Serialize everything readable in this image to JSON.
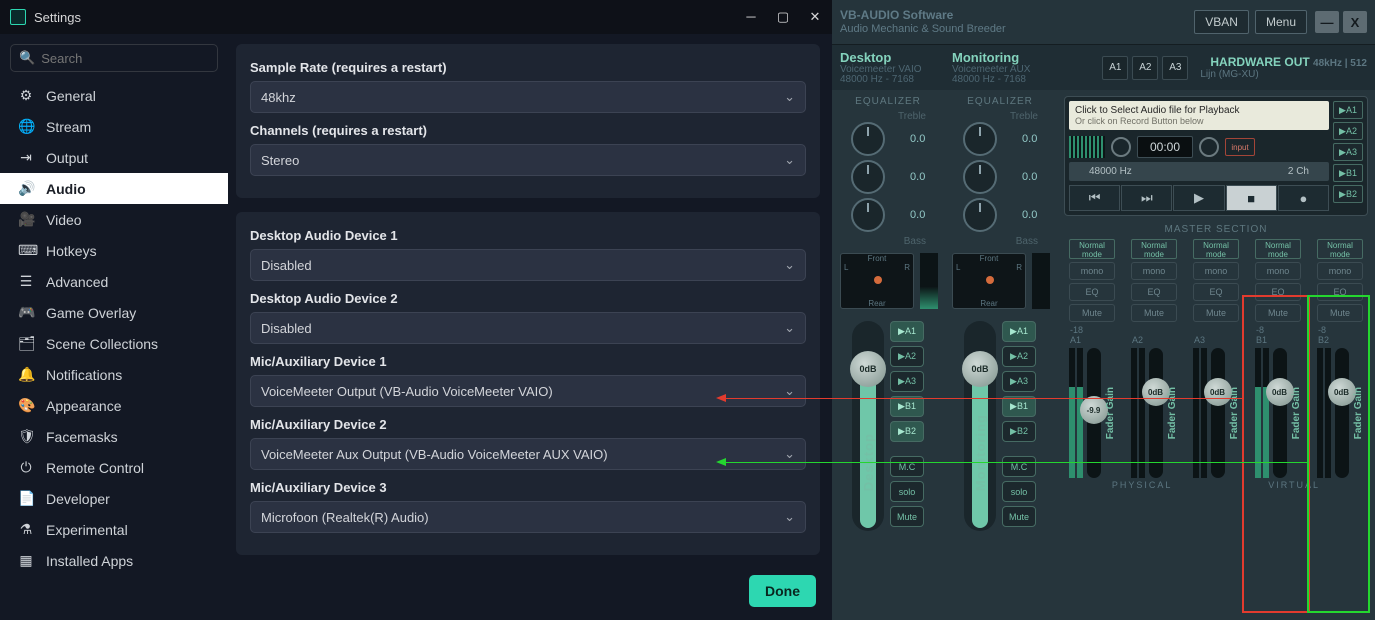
{
  "obs": {
    "title": "Settings",
    "searchPlaceholder": "Search",
    "sidebar": [
      {
        "label": "General"
      },
      {
        "label": "Stream"
      },
      {
        "label": "Output"
      },
      {
        "label": "Audio"
      },
      {
        "label": "Video"
      },
      {
        "label": "Hotkeys"
      },
      {
        "label": "Advanced"
      },
      {
        "label": "Game Overlay"
      },
      {
        "label": "Scene Collections"
      },
      {
        "label": "Notifications"
      },
      {
        "label": "Appearance"
      },
      {
        "label": "Facemasks"
      },
      {
        "label": "Remote Control"
      },
      {
        "label": "Developer"
      },
      {
        "label": "Experimental"
      },
      {
        "label": "Installed Apps"
      }
    ],
    "panel1": {
      "sampleRateLabel": "Sample Rate (requires a restart)",
      "sampleRateValue": "48khz",
      "channelsLabel": "Channels (requires a restart)",
      "channelsValue": "Stereo"
    },
    "panel2": {
      "d1l": "Desktop Audio Device 1",
      "d1v": "Disabled",
      "d2l": "Desktop Audio Device 2",
      "d2v": "Disabled",
      "m1l": "Mic/Auxiliary Device 1",
      "m1v": "VoiceMeeter Output (VB-Audio VoiceMeeter VAIO)",
      "m2l": "Mic/Auxiliary Device 2",
      "m2v": "VoiceMeeter Aux Output (VB-Audio VoiceMeeter AUX VAIO)",
      "m3l": "Mic/Auxiliary Device 3",
      "m3v": "Microfoon (Realtek(R) Audio)"
    },
    "doneLabel": "Done"
  },
  "vm": {
    "brand1": "VB-AUDIO Software",
    "brand2": "Audio Mechanic & Sound Breeder",
    "vbanLabel": "VBAN",
    "menuLabel": "Menu",
    "desktop": {
      "title": "Desktop",
      "sub1": "Voicemeeter VAIO",
      "sub2": "48000 Hz - 7168"
    },
    "monitoring": {
      "title": "Monitoring",
      "sub1": "Voicemeeter AUX",
      "sub2": "48000 Hz - 7168"
    },
    "aBtns": [
      "A1",
      "A2",
      "A3"
    ],
    "hwOut": "HARDWARE OUT",
    "hwInfo": "48kHz | 512",
    "hwSub": "Lijn (MG-XU)",
    "eqLabel": "EQUALIZER",
    "treble": "Treble",
    "bass": "Bass",
    "eqVal": "0.0",
    "ipFront": "Front",
    "ipRear": "Rear",
    "ipL": "L",
    "ipR": "R",
    "faderVal": "0dB",
    "stripDesktop": "Desktop",
    "stripMon": "Monitoring",
    "busA1": "▶A1",
    "busA2": "▶A2",
    "busA3": "▶A3",
    "busB1": "▶B1",
    "busB2": "▶B2",
    "mc": "M.C",
    "solo": "solo",
    "mute": "Mute",
    "rec": {
      "line1": "Click to Select Audio file for Playback",
      "line2": "Or click on Record Button below",
      "tc": "00:00",
      "hz": "48000 Hz",
      "ch": "2 Ch",
      "inputLabel": "input"
    },
    "recSide": [
      "▶A1",
      "▶A2",
      "▶A3",
      "▶B1",
      "▶B2"
    ],
    "masterTitle": "MASTER SECTION",
    "normalMode": "Normal mode",
    "mono": "mono",
    "eq": "EQ",
    "muteL": "Mute",
    "mLabels": [
      "A1",
      "A2",
      "A3",
      "B1",
      "B2"
    ],
    "mDbTop": [
      "-18",
      "",
      "",
      "-8",
      "-8"
    ],
    "mKnob": [
      "-9.9",
      "0dB",
      "0dB",
      "0dB",
      "0dB"
    ],
    "gain": "Fader Gain",
    "physical": "PHYSICAL",
    "virtual": "VIRTUAL"
  }
}
